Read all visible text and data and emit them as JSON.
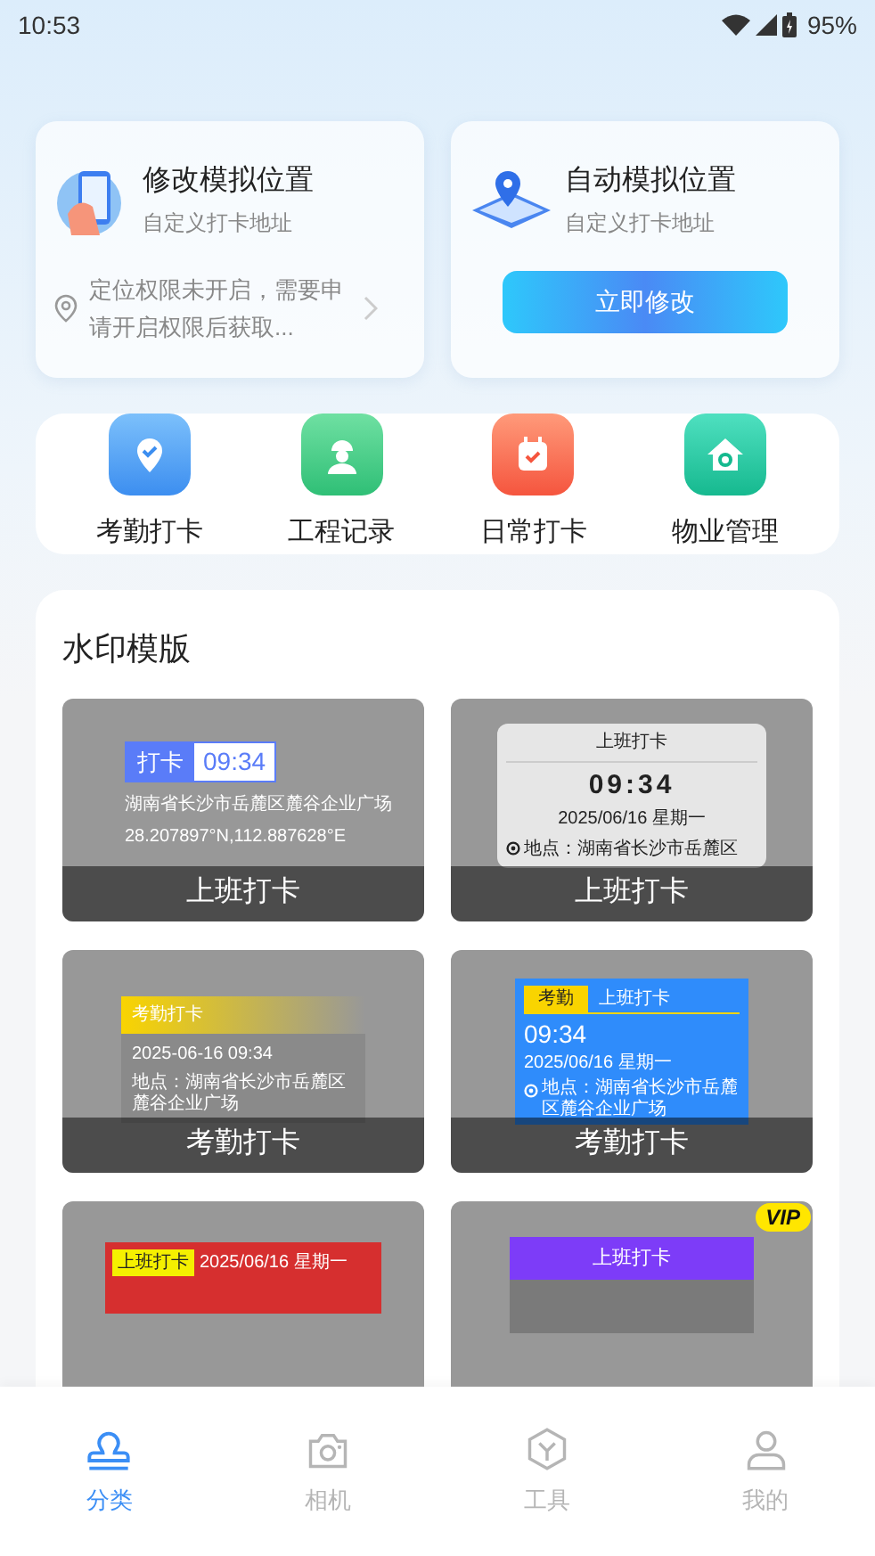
{
  "status_bar": {
    "time": "10:53",
    "battery": "95%"
  },
  "location_cards": [
    {
      "kind": "manual",
      "title": "修改模拟位置",
      "subtitle": "自定义打卡地址",
      "notice": "定位权限未开启，需要申请开启权限后获取..."
    },
    {
      "kind": "auto",
      "title": "自动模拟位置",
      "subtitle": "自定义打卡地址",
      "button": "立即修改"
    }
  ],
  "shortcuts": [
    {
      "kind": "attendance",
      "label": "考勤打卡"
    },
    {
      "kind": "project",
      "label": "工程记录"
    },
    {
      "kind": "daily",
      "label": "日常打卡"
    },
    {
      "kind": "property",
      "label": "物业管理"
    }
  ],
  "watermark_section": {
    "title": "水印模版",
    "templates": [
      {
        "kind": "badge",
        "texts": [
          "打卡",
          "09:34",
          "湖南省长沙市岳麓区麓谷企业广场",
          "28.207897°N,112.887628°E"
        ],
        "label": "上班打卡"
      },
      {
        "kind": "calendar",
        "texts": [
          "上班打卡",
          "09:34",
          "2025/06/16  星期一",
          "地点：湖南省长沙市岳麓区"
        ],
        "label": "上班打卡"
      },
      {
        "kind": "yellow",
        "texts": [
          "考勤打卡",
          "2025-06-16   09:34",
          "地点：湖南省长沙市岳麓区麓谷企业广场"
        ],
        "label": "考勤打卡"
      },
      {
        "kind": "blue",
        "texts": [
          "考勤",
          "上班打卡",
          "09:34",
          "2025/06/16  星期一",
          "地点：湖南省长沙市岳麓区麓谷企业广场"
        ],
        "label": "考勤打卡"
      },
      {
        "kind": "red",
        "texts": [
          "上班打卡",
          "2025/06/16",
          "星期一"
        ]
      },
      {
        "kind": "purple",
        "vip": "VIP",
        "texts": [
          "上班打卡"
        ]
      }
    ]
  },
  "bottom_nav": [
    {
      "kind": "category",
      "label": "分类",
      "selected": true
    },
    {
      "kind": "camera",
      "label": "相机",
      "selected": false
    },
    {
      "kind": "tools",
      "label": "工具",
      "selected": false
    },
    {
      "kind": "profile",
      "label": "我的",
      "selected": false
    }
  ]
}
